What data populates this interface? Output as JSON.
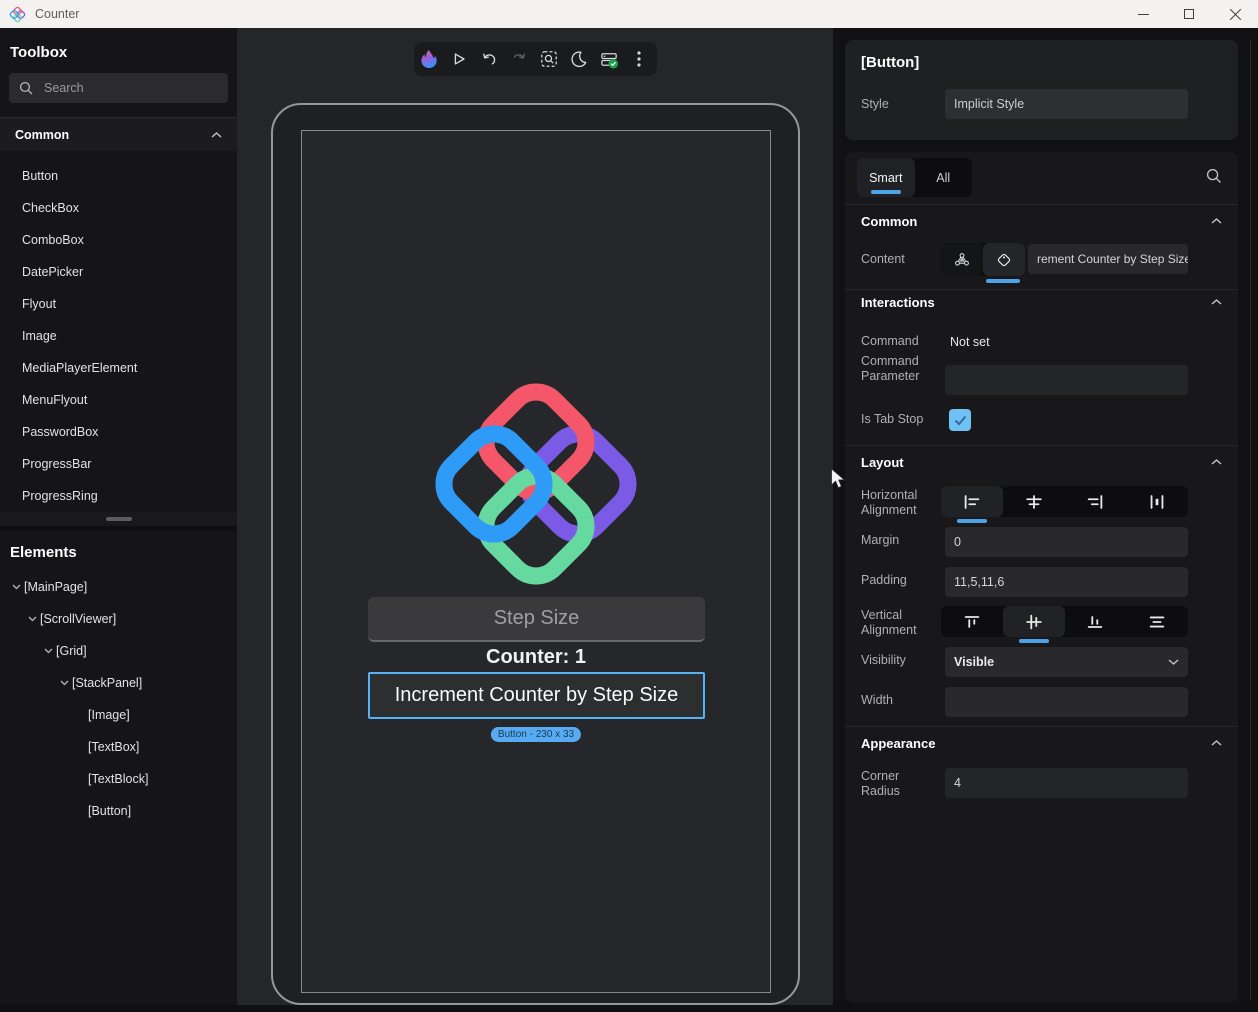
{
  "titlebar": {
    "app_title": "Counter",
    "controls": [
      "minimize",
      "maximize",
      "close"
    ]
  },
  "toolbox": {
    "title": "Toolbox",
    "search_placeholder": "Search",
    "section_label": "Common",
    "items": [
      "Button",
      "CheckBox",
      "ComboBox",
      "DatePicker",
      "Flyout",
      "Image",
      "MediaPlayerElement",
      "MenuFlyout",
      "PasswordBox",
      "ProgressBar",
      "ProgressRing"
    ]
  },
  "elements": {
    "title": "Elements",
    "tree": [
      {
        "label": "[MainPage]",
        "depth": 0,
        "expandable": true
      },
      {
        "label": "[ScrollViewer]",
        "depth": 1,
        "expandable": true
      },
      {
        "label": "[Grid]",
        "depth": 2,
        "expandable": true
      },
      {
        "label": "[StackPanel]",
        "depth": 3,
        "expandable": true
      },
      {
        "label": "[Image]",
        "depth": 4,
        "expandable": false
      },
      {
        "label": "[TextBox]",
        "depth": 4,
        "expandable": false
      },
      {
        "label": "[TextBlock]",
        "depth": 4,
        "expandable": false
      },
      {
        "label": "[Button]",
        "depth": 4,
        "expandable": false
      }
    ]
  },
  "canvas": {
    "toolbar_icons": [
      "hot-reload-flame",
      "play",
      "undo",
      "redo",
      "inspect-element",
      "dark-mode-moon",
      "connection-status-ok",
      "more-options"
    ],
    "device": {
      "textbox_placeholder": "Step Size",
      "counter_text": "Counter: 1",
      "button_label": "Increment Counter by Step Size",
      "selection_badge": "Button - 230 x 33"
    }
  },
  "inspector": {
    "header_title": "[Button]",
    "style_row": {
      "label": "Style",
      "value": "Implicit Style"
    },
    "tabs": {
      "smart": "Smart",
      "all": "All"
    },
    "common": {
      "title": "Common",
      "content_label": "Content",
      "content_value": "rement Counter by Step Size"
    },
    "interactions": {
      "title": "Interactions",
      "command_label": "Command",
      "command_value": "Not set",
      "command_parameter_label": "Command Parameter",
      "command_parameter_value": "",
      "is_tab_stop_label": "Is Tab Stop",
      "is_tab_stop_checked": true
    },
    "layout": {
      "title": "Layout",
      "horizontal_alignment_label": "Horizontal Alignment",
      "horizontal_alignment_value": "Left",
      "margin_label": "Margin",
      "margin_value": "0",
      "padding_label": "Padding",
      "padding_value": "11,5,11,6",
      "vertical_alignment_label": "Vertical Alignment",
      "vertical_alignment_value": "Center",
      "visibility_label": "Visibility",
      "visibility_value": "Visible",
      "width_label": "Width",
      "width_value": ""
    },
    "appearance": {
      "title": "Appearance",
      "corner_radius_label": "Corner Radius",
      "corner_radius_value": "4"
    }
  },
  "colors": {
    "accent_blue": "#4da3e8",
    "selection_blue": "#57b2f3",
    "badge_bg": "#58abf2",
    "status_green": "#18a24c",
    "logo_red": "#f4566a",
    "logo_blue": "#2e9bf7",
    "logo_purple": "#7b5be6",
    "logo_green": "#66d9a0"
  }
}
